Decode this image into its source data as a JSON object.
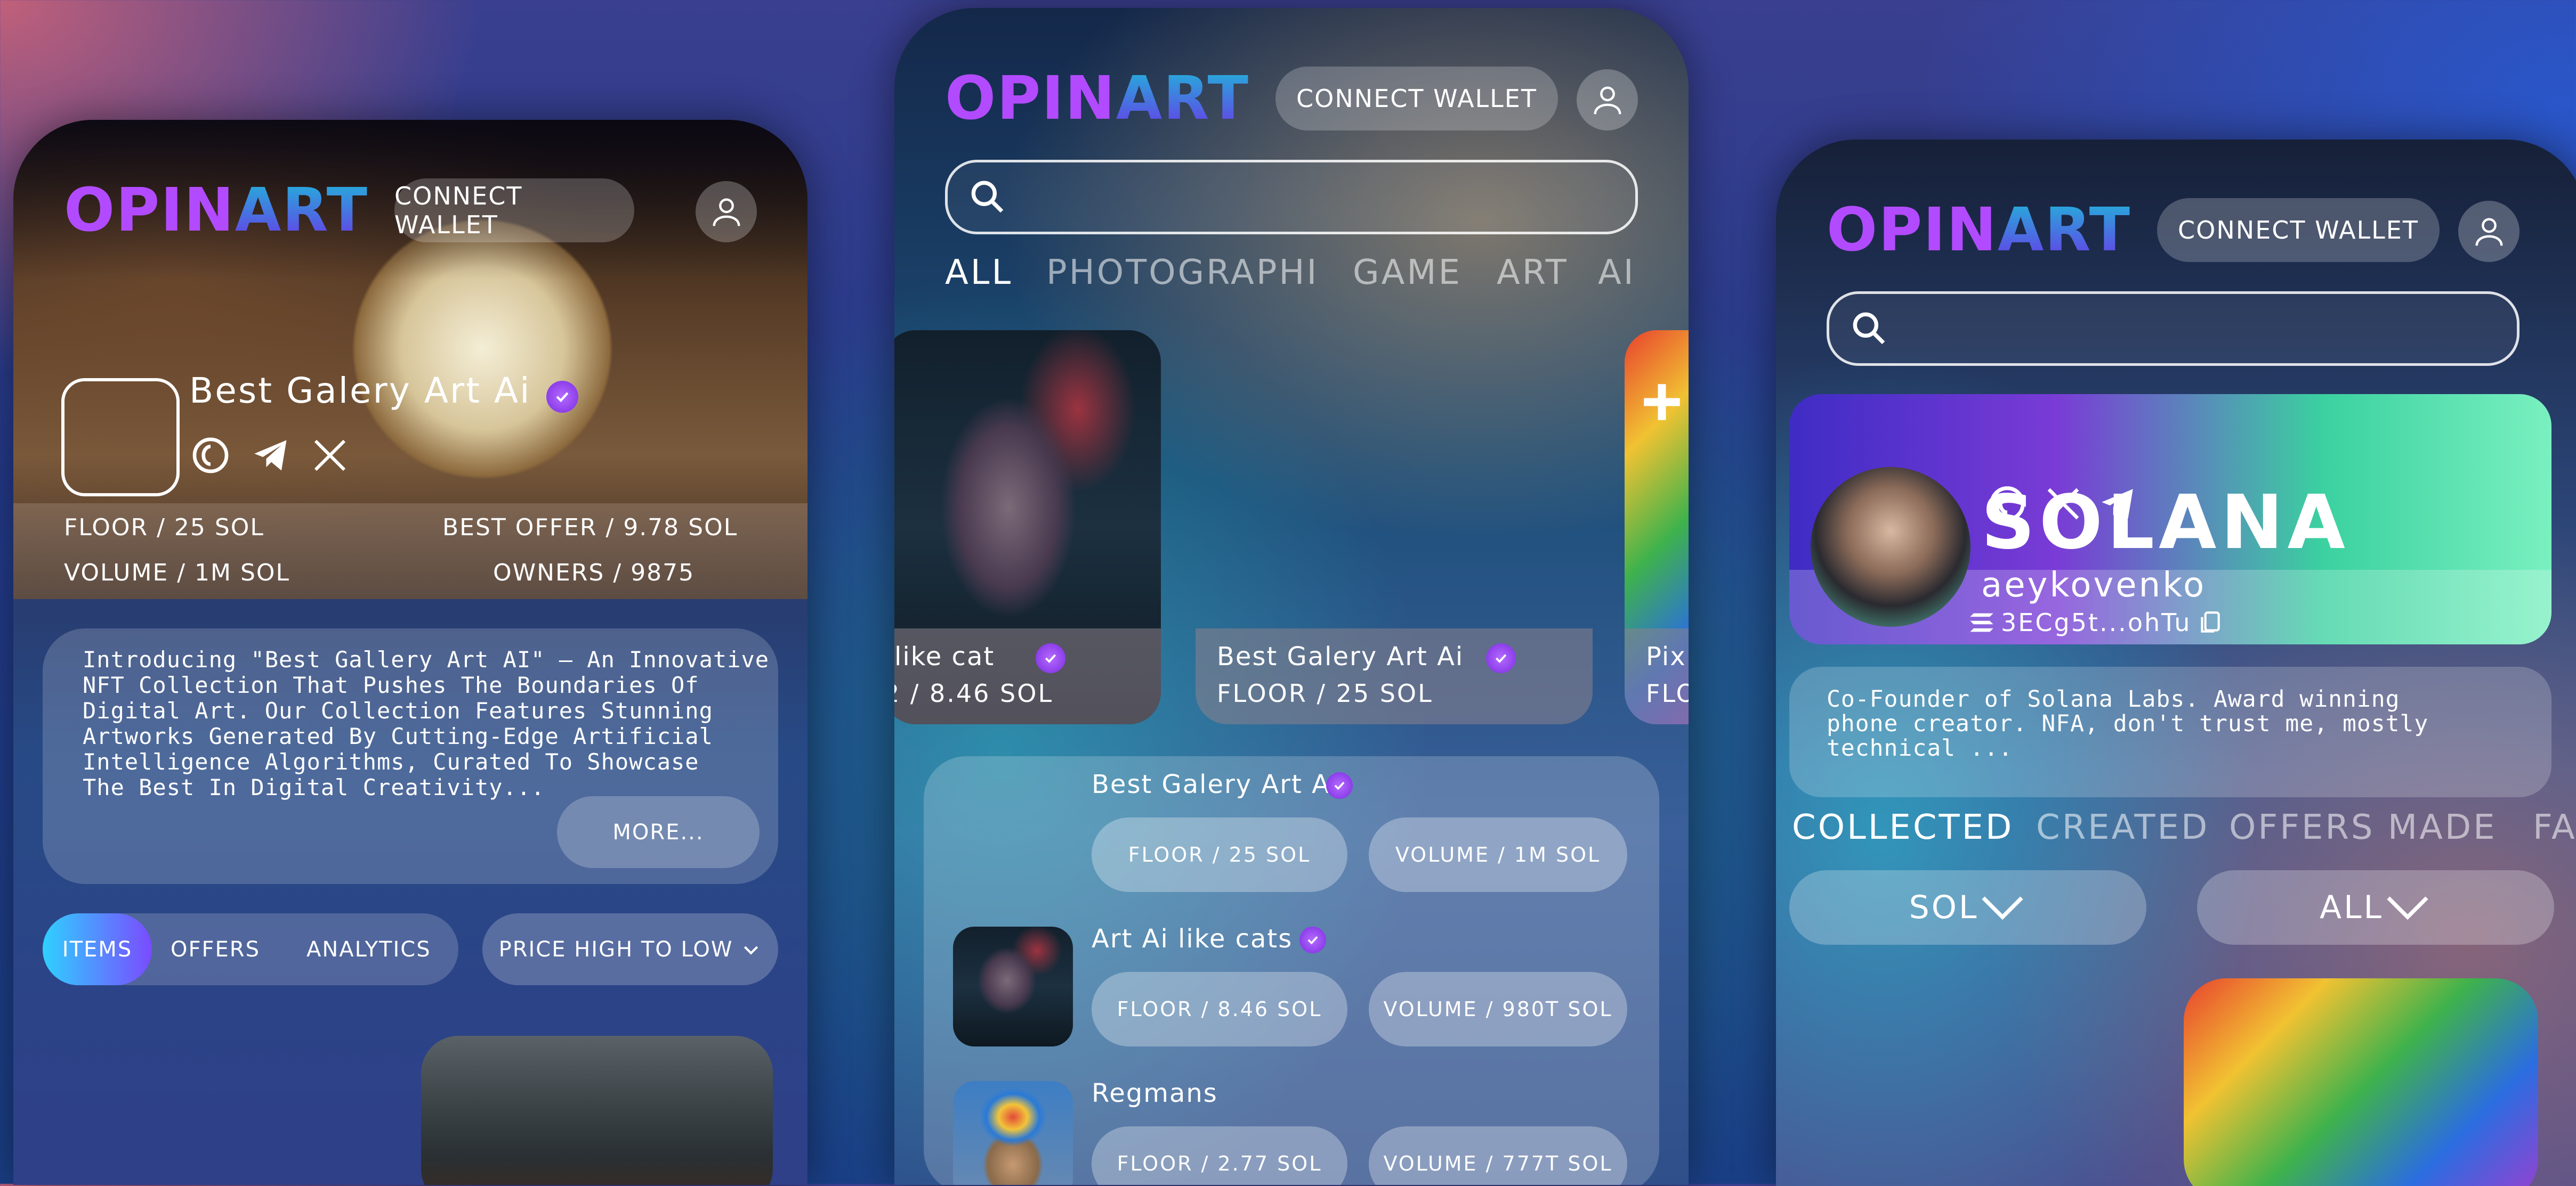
{
  "brand": {
    "logo_part1": "OPIN",
    "logo_part2": "ART"
  },
  "colors": {
    "accent_purple": "#b24bff",
    "accent_cyan": "#2fd0ff",
    "verified": "#9b4bff"
  },
  "header": {
    "connect_wallet": "CONNECT WALLET"
  },
  "collection_page": {
    "name": "Best Galery Art Ai",
    "stats": {
      "floor": "FLOOR / 25 SOL",
      "best_offer": "BEST OFFER / 9.78 SOL",
      "volume": "VOLUME / 1M SOL",
      "owners": "OWNERS / 9875"
    },
    "description_lines": [
      "Introducing \"Best Gallery Art AI\" — An Innovative",
      "NFT Collection That Pushes The Boundaries Of",
      "Digital Art. Our Collection Features Stunning",
      "Artworks Generated By Cutting-Edge Artificial",
      "Intelligence Algorithms, Curated To Showcase",
      "The Best In Digital Creativity..."
    ],
    "more": "MORE...",
    "tabs": [
      "ITEMS",
      "OFFERS",
      "ANALYTICS"
    ],
    "sort": "PRICE HIGH TO LOW"
  },
  "explore_page": {
    "categories": [
      "ALL",
      "PHOTOGRAPHI",
      "GAME",
      "ART",
      "AI"
    ],
    "cards": [
      {
        "name": "like cat",
        "floor": "2 / 8.46 SOL"
      },
      {
        "name": "Best Galery Art Ai",
        "floor": "FLOOR / 25 SOL"
      },
      {
        "name": "Pix",
        "floor": "FLO"
      }
    ],
    "list": [
      {
        "name": "Best Galery Art Ai",
        "floor": "FLOOR / 25 SOL",
        "volume": "VOLUME / 1M SOL"
      },
      {
        "name": "Art Ai like cats",
        "floor": "FLOOR / 8.46 SOL",
        "volume": "VOLUME / 980T SOL"
      },
      {
        "name": "Regmans",
        "floor": "FLOOR / 2.77 SOL",
        "volume": "VOLUME / 777T SOL"
      }
    ]
  },
  "profile_page": {
    "banner_text": "SOLANA",
    "username": "aeykovenko",
    "wallet": "3ECg5t...ohTu",
    "bio_lines": [
      "Co-Founder of Solana Labs. Award winning",
      "phone creator. NFA, don't trust me, mostly",
      "technical ..."
    ],
    "tabs": [
      "COLLECTED",
      "CREATED",
      "OFFERS MADE",
      "FA"
    ],
    "filters": [
      "SOL",
      "ALL"
    ]
  }
}
